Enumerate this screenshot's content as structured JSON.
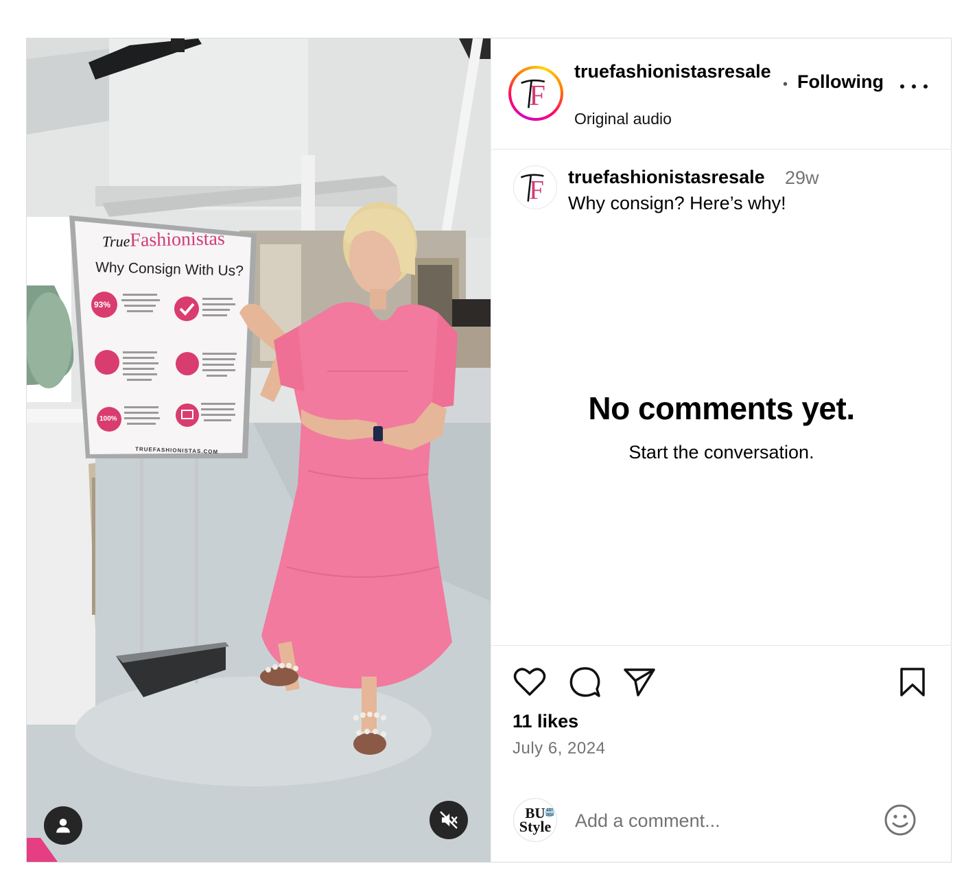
{
  "post": {
    "media": {
      "poster": {
        "brand_pre": "True",
        "brand": "Fashionistas",
        "headline": "Why Consign With Us?",
        "stat_1": "93%",
        "stat_2": "100%",
        "url": "TRUEFASHIONISTAS.COM"
      },
      "user_icon": "user-icon",
      "mute_icon": "speaker-muted-icon"
    },
    "header": {
      "username": "truefashionistasresale",
      "audio": "Original audio",
      "separator": "•",
      "follow_label": "Following",
      "more_icon": "more-options-icon"
    },
    "caption": {
      "username": "truefashionistasresale",
      "time_ago": "29w",
      "text": "Why consign? Here’s why!"
    },
    "comments": {
      "empty_title": "No comments yet.",
      "empty_subtitle": "Start the conversation."
    },
    "actions": {
      "like_icon": "heart-icon",
      "comment_icon": "comment-icon",
      "share_icon": "send-icon",
      "save_icon": "bookmark-icon"
    },
    "likes": "11 likes",
    "date": "July 6, 2024",
    "add_comment": {
      "placeholder": "Add a comment...",
      "avatar_text_1": "BU",
      "avatar_text_2": "Style",
      "avatar_badge": "EST 2010",
      "emoji_icon": "emoji-icon"
    },
    "logo_letters": "TF",
    "colors": {
      "brand_pink": "#d23b78",
      "dress_pink": "#f27a9e",
      "muted_text": "#737373",
      "border": "#dbdbdb"
    }
  }
}
